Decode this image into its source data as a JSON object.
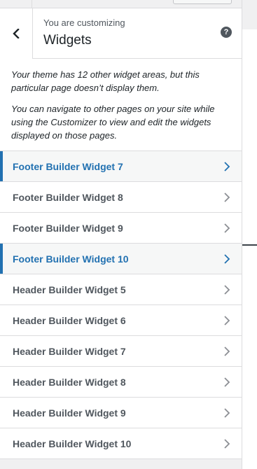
{
  "header": {
    "pre_title": "You are customizing",
    "title": "Widgets",
    "help_symbol": "?"
  },
  "notice": {
    "paragraph1": "Your theme has 12 other widget areas, but this particular page doesn’t display them.",
    "paragraph2": "You can navigate to other pages on your site while using the Customizer to view and edit the widgets displayed on those pages."
  },
  "widgets": [
    {
      "label": "Footer Builder Widget 7",
      "active": true
    },
    {
      "label": "Footer Builder Widget 8",
      "active": false
    },
    {
      "label": "Footer Builder Widget 9",
      "active": false
    },
    {
      "label": "Footer Builder Widget 10",
      "active": true
    },
    {
      "label": "Header Builder Widget 5",
      "active": false
    },
    {
      "label": "Header Builder Widget 6",
      "active": false
    },
    {
      "label": "Header Builder Widget 7",
      "active": false
    },
    {
      "label": "Header Builder Widget 8",
      "active": false
    },
    {
      "label": "Header Builder Widget 9",
      "active": false
    },
    {
      "label": "Header Builder Widget 10",
      "active": false
    }
  ],
  "colors": {
    "accent": "#2271b1",
    "text_muted": "#50575e",
    "panel_bg": "#f0f0f1"
  },
  "icons": {
    "back": "chevron-left-icon",
    "help": "help-icon",
    "row": "chevron-right-icon"
  }
}
